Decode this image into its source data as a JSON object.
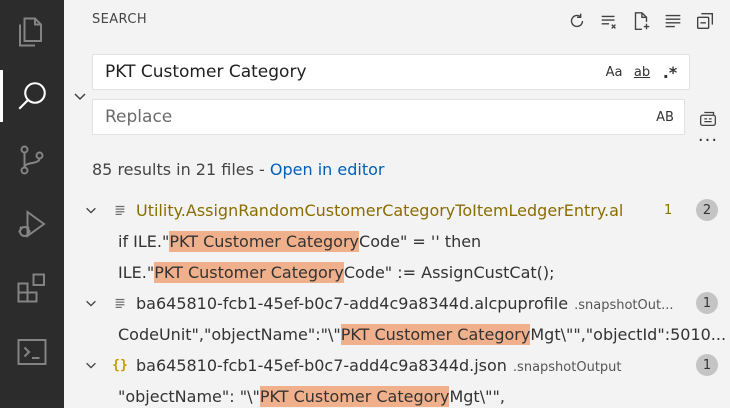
{
  "view": {
    "title": "SEARCH"
  },
  "activity_bar": [
    {
      "name": "explorer-icon"
    },
    {
      "name": "search-icon",
      "active": true
    },
    {
      "name": "source-control-icon"
    },
    {
      "name": "run-debug-icon"
    },
    {
      "name": "extensions-icon"
    },
    {
      "name": "terminal-icon"
    }
  ],
  "title_actions": [
    "refresh-icon",
    "clear-results-icon",
    "new-search-editor-icon",
    "view-as-tree-icon",
    "collapse-all-icon"
  ],
  "search": {
    "value": "PKT Customer Category",
    "options": {
      "match_case": "Aa",
      "whole_word": "ab",
      "regex": ".*"
    }
  },
  "replace": {
    "placeholder": "Replace",
    "preserve_case": "AB"
  },
  "more": "···",
  "summary": {
    "text": "85 results in 21 files - ",
    "link": "Open in editor"
  },
  "results": [
    {
      "file": "Utility.AssignRandomCustomerCategoryToItemLedgerEntry.al",
      "dir": "",
      "problem_count": "1",
      "count": "2",
      "icon": "file-lines-icon",
      "matches": [
        {
          "pre": "if ILE.\"",
          "hit": "PKT Customer Category",
          "post": " Code\" = '' then"
        },
        {
          "pre": "ILE.\"",
          "hit": "PKT Customer Category",
          "post": " Code\" := AssignCustCat();"
        }
      ]
    },
    {
      "file": "ba645810-fcb1-45ef-b0c7-add4c9a8344d.alcpuprofile",
      "dir": ".snapshotOut...",
      "problem_count": "",
      "count": "1",
      "icon": "file-lines-icon",
      "matches": [
        {
          "pre": "CodeUnit\",\"objectName\":\"\\\"",
          "hit": "PKT Customer Category",
          "post": " Mgt\\\"\",\"objectId\":5010..."
        }
      ]
    },
    {
      "file": "ba645810-fcb1-45ef-b0c7-add4c9a8344d.json",
      "dir": ".snapshotOutput",
      "problem_count": "",
      "count": "1",
      "icon": "json-icon",
      "matches": [
        {
          "pre": "\"objectName\": \"\\\"",
          "hit": "PKT Customer Category",
          "post": " Mgt\\\"\","
        }
      ]
    }
  ]
}
